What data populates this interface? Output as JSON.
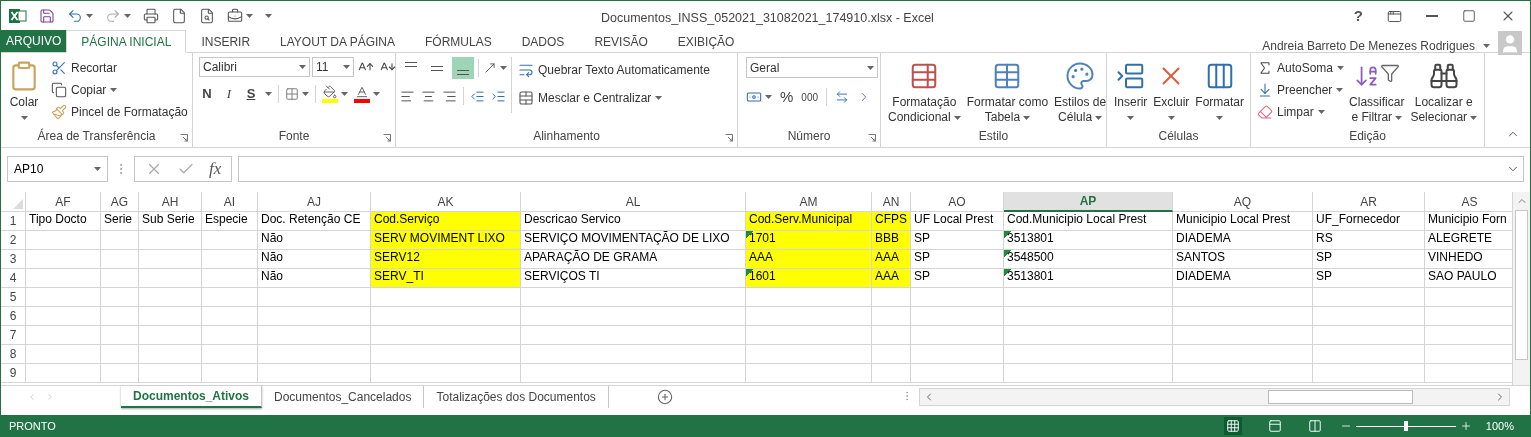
{
  "window": {
    "title": "Documentos_INSS_052021_31082021_174910.xlsx - Excel",
    "help": "?"
  },
  "file_tab": {
    "label": "ARQUIVO"
  },
  "tabs": [
    {
      "label": "PÁGINA INICIAL",
      "selected": true
    },
    {
      "label": "INSERIR",
      "selected": false
    },
    {
      "label": "LAYOUT DA PÁGINA",
      "selected": false
    },
    {
      "label": "FÓRMULAS",
      "selected": false
    },
    {
      "label": "DADOS",
      "selected": false
    },
    {
      "label": "REVISÃO",
      "selected": false
    },
    {
      "label": "EXIBIÇÃO",
      "selected": false
    }
  ],
  "user": {
    "name": "Andreia Barreto De Menezes Rodrigues"
  },
  "ribbon": {
    "clipboard": {
      "label": "Área de Transferência",
      "paste": "Colar",
      "cut": "Recortar",
      "copy": "Copiar",
      "format_painter": "Pincel de Formatação"
    },
    "font": {
      "label": "Fonte",
      "family": "Calibri",
      "size": "11",
      "bold": "N",
      "italic": "I",
      "underline": "S"
    },
    "alignment": {
      "label": "Alinhamento",
      "vertical": [
        {
          "selected": false
        },
        {
          "selected": false
        },
        {
          "selected": true
        }
      ],
      "wrap_text": "Quebrar Texto Automaticamente",
      "merge": "Mesclar e Centralizar"
    },
    "number": {
      "label": "Número",
      "format": "Geral",
      "percent": "%",
      "thousands": "000"
    },
    "styles": {
      "label": "Estilo",
      "buttons": [
        {
          "lines": [
            "Formatação",
            "Condicional"
          ]
        },
        {
          "lines": [
            "Formatar como",
            "Tabela"
          ]
        },
        {
          "lines": [
            "Estilos de",
            "Célula"
          ]
        }
      ]
    },
    "cells": {
      "label": "Células",
      "buttons": [
        "Inserir",
        "Excluir",
        "Formatar"
      ]
    },
    "editing": {
      "label": "Edição",
      "autosum": "AutoSoma",
      "fill": "Preencher",
      "clear": "Limpar",
      "sort": [
        "Classificar",
        "e Filtrar"
      ],
      "find": [
        "Localizar e",
        "Selecionar"
      ]
    }
  },
  "formula_bar": {
    "name_box": "AP10",
    "fx": "fx"
  },
  "sheet": {
    "columns": [
      {
        "label": "AF",
        "selected": false
      },
      {
        "label": "AG",
        "selected": false
      },
      {
        "label": "AH",
        "selected": false
      },
      {
        "label": "AI",
        "selected": false
      },
      {
        "label": "AJ",
        "selected": false
      },
      {
        "label": "AK",
        "selected": false
      },
      {
        "label": "AL",
        "selected": false
      },
      {
        "label": "AM",
        "selected": false
      },
      {
        "label": "AN",
        "selected": false
      },
      {
        "label": "AO",
        "selected": false
      },
      {
        "label": "AP",
        "selected": true
      },
      {
        "label": "AQ",
        "selected": false
      },
      {
        "label": "AR",
        "selected": false
      },
      {
        "label": "AS",
        "selected": false
      }
    ],
    "rows": [
      {
        "number": "1",
        "cells": [
          {
            "text": "Tipo Docto",
            "highlighted": false,
            "flagged": false
          },
          {
            "text": "Serie",
            "highlighted": false,
            "flagged": false
          },
          {
            "text": "Sub Serie",
            "highlighted": false,
            "flagged": false
          },
          {
            "text": "Especie",
            "highlighted": false,
            "flagged": false
          },
          {
            "text": "Doc. Retenção CE",
            "highlighted": false,
            "flagged": false
          },
          {
            "text": "Cod.Serviço",
            "highlighted": true,
            "flagged": false
          },
          {
            "text": "Descricao Servico",
            "highlighted": false,
            "flagged": false
          },
          {
            "text": "Cod.Serv.Municipal",
            "highlighted": true,
            "flagged": false
          },
          {
            "text": "CFPS",
            "highlighted": true,
            "flagged": false
          },
          {
            "text": "UF Local Prest",
            "highlighted": false,
            "flagged": false
          },
          {
            "text": "Cod.Municipio Local Prest",
            "highlighted": false,
            "flagged": false
          },
          {
            "text": "Municipio Local Prest",
            "highlighted": false,
            "flagged": false
          },
          {
            "text": "UF_Fornecedor",
            "highlighted": false,
            "flagged": false
          },
          {
            "text": "Municipio Forn",
            "highlighted": false,
            "flagged": false
          }
        ]
      },
      {
        "number": "2",
        "cells": [
          {
            "highlighted": false,
            "flagged": false
          },
          {
            "highlighted": false,
            "flagged": false
          },
          {
            "highlighted": false,
            "flagged": false
          },
          {
            "highlighted": false,
            "flagged": false
          },
          {
            "text": "Não",
            "highlighted": false,
            "flagged": false
          },
          {
            "text": "SERV MOVIMENT LIXO",
            "highlighted": true,
            "flagged": false
          },
          {
            "text": "SERVIÇO MOVIMENTAÇÃO DE LIXO",
            "highlighted": false,
            "flagged": false
          },
          {
            "text": "1701",
            "highlighted": true,
            "flagged": true
          },
          {
            "text": "BBB",
            "highlighted": true,
            "flagged": false
          },
          {
            "text": "SP",
            "highlighted": false,
            "flagged": false
          },
          {
            "text": "3513801",
            "highlighted": false,
            "flagged": true
          },
          {
            "text": "DIADEMA",
            "highlighted": false,
            "flagged": false
          },
          {
            "text": "RS",
            "highlighted": false,
            "flagged": false
          },
          {
            "text": "ALEGRETE",
            "highlighted": false,
            "flagged": false
          }
        ]
      },
      {
        "number": "3",
        "cells": [
          {
            "highlighted": false,
            "flagged": false
          },
          {
            "highlighted": false,
            "flagged": false
          },
          {
            "highlighted": false,
            "flagged": false
          },
          {
            "highlighted": false,
            "flagged": false
          },
          {
            "text": "Não",
            "highlighted": false,
            "flagged": false
          },
          {
            "text": "SERV12",
            "highlighted": true,
            "flagged": false
          },
          {
            "text": "APARAÇÃO DE GRAMA",
            "highlighted": false,
            "flagged": false
          },
          {
            "text": "AAA",
            "highlighted": true,
            "flagged": false
          },
          {
            "text": "AAA",
            "highlighted": true,
            "flagged": false
          },
          {
            "text": "SP",
            "highlighted": false,
            "flagged": false
          },
          {
            "text": "3548500",
            "highlighted": false,
            "flagged": true
          },
          {
            "text": "SANTOS",
            "highlighted": false,
            "flagged": false
          },
          {
            "text": "SP",
            "highlighted": false,
            "flagged": false
          },
          {
            "text": "VINHEDO",
            "highlighted": false,
            "flagged": false
          }
        ]
      },
      {
        "number": "4",
        "cells": [
          {
            "highlighted": false,
            "flagged": false
          },
          {
            "highlighted": false,
            "flagged": false
          },
          {
            "highlighted": false,
            "flagged": false
          },
          {
            "highlighted": false,
            "flagged": false
          },
          {
            "text": "Não",
            "highlighted": false,
            "flagged": false
          },
          {
            "text": "SERV_TI",
            "highlighted": true,
            "flagged": false
          },
          {
            "text": "SERVIÇOS TI",
            "highlighted": false,
            "flagged": false
          },
          {
            "text": "1601",
            "highlighted": true,
            "flagged": true
          },
          {
            "text": "AAA",
            "highlighted": true,
            "flagged": false
          },
          {
            "text": "SP",
            "highlighted": false,
            "flagged": false
          },
          {
            "text": "3513801",
            "highlighted": false,
            "flagged": true
          },
          {
            "text": "DIADEMA",
            "highlighted": false,
            "flagged": false
          },
          {
            "text": "SP",
            "highlighted": false,
            "flagged": false
          },
          {
            "text": "SAO PAULO",
            "highlighted": false,
            "flagged": false
          }
        ]
      },
      {
        "number": "5"
      },
      {
        "number": "6"
      },
      {
        "number": "7"
      },
      {
        "number": "8"
      },
      {
        "number": "9"
      }
    ]
  },
  "sheet_tabs": [
    {
      "label": "Documentos_Ativos",
      "selected": true
    },
    {
      "label": "Documentos_Cancelados",
      "selected": false
    },
    {
      "label": "Totalizações dos Documentos",
      "selected": false
    }
  ],
  "status_bar": {
    "mode": "PRONTO",
    "zoom": "100%",
    "zoom_slider": {
      "level": 0.5
    }
  }
}
